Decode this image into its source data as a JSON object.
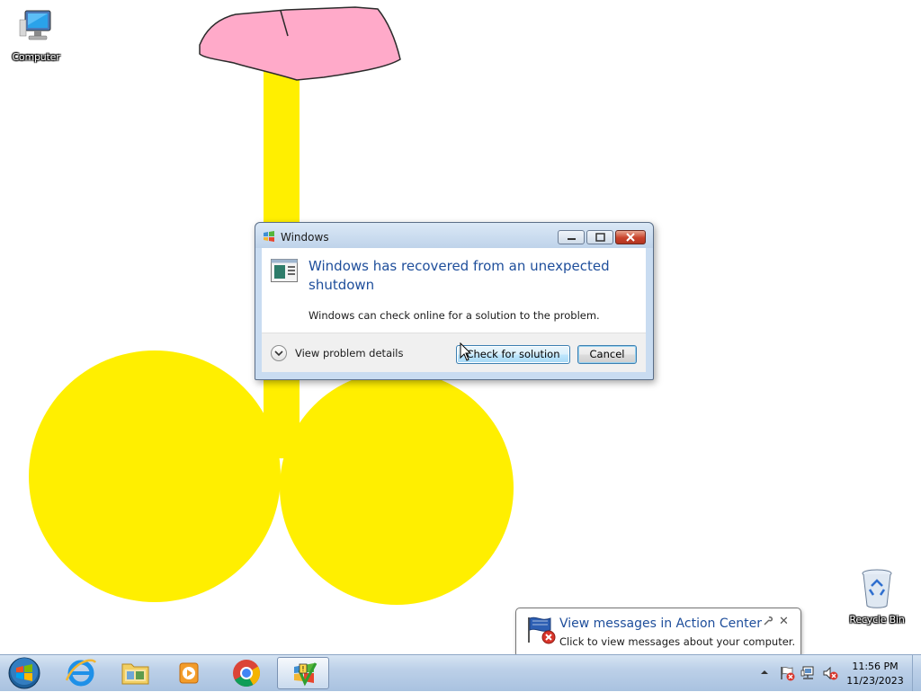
{
  "desktop": {
    "icons": [
      {
        "label": "Computer"
      },
      {
        "label": "Recycle Bin"
      }
    ],
    "drawing": {
      "petal_color": "#ffaac9",
      "shape_color": "#ffef00"
    }
  },
  "dialog": {
    "title": "Windows",
    "heading": "Windows has recovered from an unexpected shutdown",
    "message": "Windows can check online for a solution to the problem.",
    "details_label": "View problem details",
    "primary_button": "Check for solution",
    "cancel_button": "Cancel"
  },
  "taskbar": {
    "items": [
      "start-orb",
      "internet-explorer",
      "windows-explorer",
      "windows-media-player",
      "google-chrome",
      "problem-reporting"
    ],
    "active_item": "problem-reporting",
    "tray": {
      "icons": [
        "action-center-icon",
        "network-icon",
        "volume-muted-icon"
      ],
      "time": "11:56 PM",
      "date": "11/23/2023"
    }
  },
  "balloon": {
    "title": "View messages in Action Center",
    "text": "Click to view messages about your computer."
  },
  "colors": {
    "heading_blue": "#1e4e9b",
    "taskbar": "#bcd0e8"
  }
}
